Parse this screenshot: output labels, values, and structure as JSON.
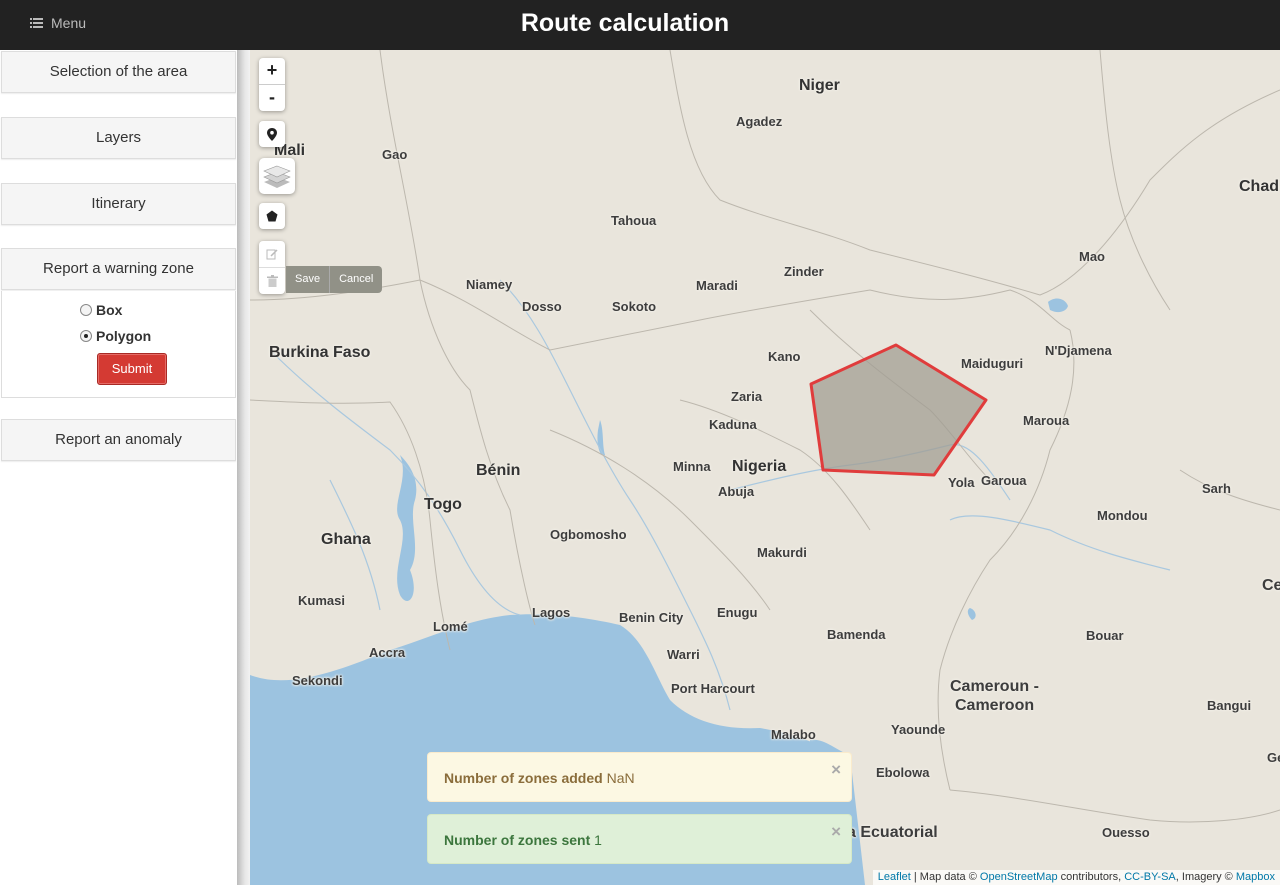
{
  "header": {
    "menu_label": "Menu",
    "title": "Route calculation"
  },
  "sidebar": {
    "panels": [
      {
        "label": "Selection of the area"
      },
      {
        "label": "Layers"
      },
      {
        "label": "Itinerary"
      },
      {
        "label": "Report a warning zone"
      },
      {
        "label": "Report an anomaly"
      }
    ],
    "warning_zone": {
      "options": [
        {
          "label": "Box",
          "checked": false
        },
        {
          "label": "Polygon",
          "checked": true
        }
      ],
      "submit_label": "Submit"
    }
  },
  "map": {
    "zoom_in": "+",
    "zoom_out": "-",
    "draw_actions": {
      "save": "Save",
      "cancel": "Cancel"
    },
    "labels": [
      "Niger",
      "Agadez",
      "Mali",
      "Gao",
      "Chad",
      "Tahoua",
      "Mao",
      "Zinder",
      "Maradi",
      "Niamey",
      "Dosso",
      "Sokoto",
      "N'Djamena",
      "Kano",
      "Maiduguri",
      "Burkina Faso",
      "Zaria",
      "Kaduna",
      "Maroua",
      "Minna",
      "Nigeria",
      "Abuja",
      "Yola",
      "Garoua",
      "Bénin",
      "Sarh",
      "Togo",
      "Mondou",
      "Ghana",
      "Ogbomosho",
      "Makurdi",
      "Kumasi",
      "Lagos",
      "Benin City",
      "Enugu",
      "Bamenda",
      "Bouar",
      "Lomé",
      "Warri",
      "Accra",
      "Sekondi",
      "Port Harcourt",
      "Cameroun -",
      "Cameroon",
      "Bangui",
      "Malabo",
      "Yaounde",
      "Ebolowa",
      "a Ecuatorial",
      "Ouesso",
      "Cer",
      "Ge"
    ],
    "zone_color": "#e03c3c"
  },
  "alerts": [
    {
      "label": "Number of zones added",
      "value": "NaN",
      "close": "×"
    },
    {
      "label": "Number of zones sent",
      "value": "1",
      "close": "×"
    }
  ],
  "attribution": {
    "leaflet": "Leaflet",
    "sep1": "| Map data ©",
    "osm": "OpenStreetMap",
    "contributors": "contributors,",
    "license": "CC-BY-SA",
    "imagery": ", Imagery ©",
    "mapbox": "Mapbox"
  }
}
